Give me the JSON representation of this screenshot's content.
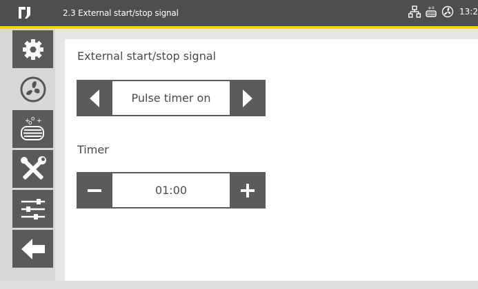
{
  "header": {
    "title": "2.3 External start/stop signal",
    "clock": "13:2",
    "colors": {
      "bar": "#4e4e4e",
      "accent": "#f5d800"
    }
  },
  "sidebar": {
    "items": [
      {
        "icon": "gear-icon",
        "state": "dark"
      },
      {
        "icon": "fan-icon",
        "state": "selected"
      },
      {
        "icon": "heater-icon",
        "state": "dark"
      },
      {
        "icon": "tools-icon",
        "state": "dark"
      },
      {
        "icon": "sliders-icon",
        "state": "dark"
      },
      {
        "icon": "back-arrow-icon",
        "state": "dark"
      }
    ]
  },
  "main": {
    "mode": {
      "label": "External start/stop signal",
      "value": "Pulse timer on",
      "prev_icon": "triangle-left-icon",
      "next_icon": "triangle-right-icon"
    },
    "timer": {
      "label": "Timer",
      "value": "01:00",
      "decrement_icon": "minus-icon",
      "increment_icon": "plus-icon"
    }
  }
}
